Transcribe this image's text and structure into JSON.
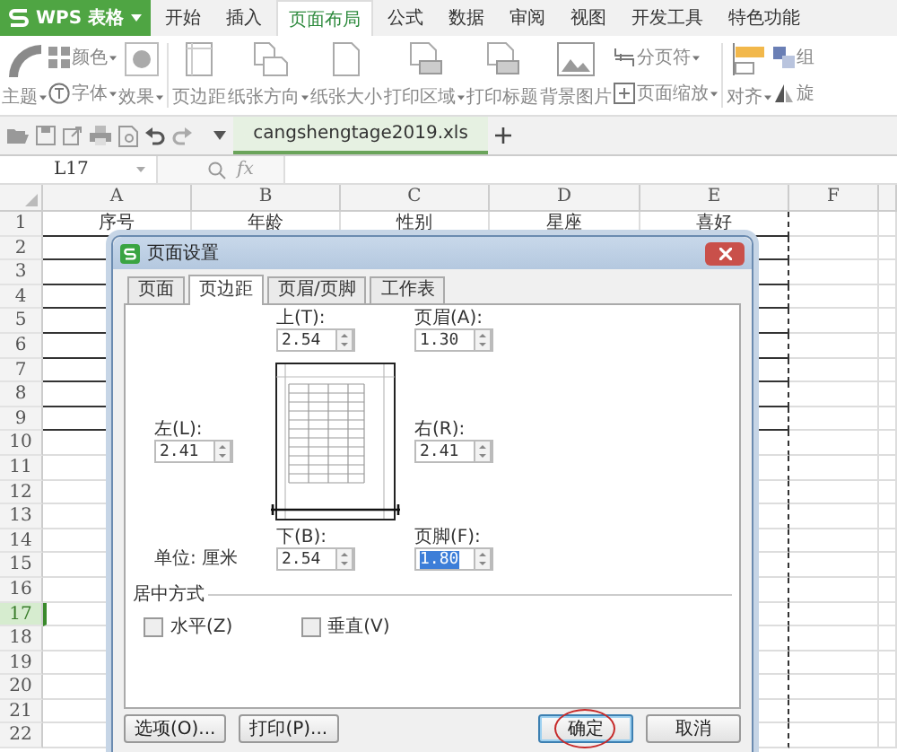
{
  "app_button": {
    "label": "WPS 表格"
  },
  "tabs": [
    {
      "label": "开始",
      "selected": false
    },
    {
      "label": "插入",
      "selected": false
    },
    {
      "label": "页面布局",
      "selected": true
    },
    {
      "label": "公式",
      "selected": false
    },
    {
      "label": "数据",
      "selected": false
    },
    {
      "label": "审阅",
      "selected": false
    },
    {
      "label": "视图",
      "selected": false
    },
    {
      "label": "开发工具",
      "selected": false
    },
    {
      "label": "特色功能",
      "selected": false
    }
  ],
  "ribbon": {
    "groups": [
      {
        "items": [
          {
            "kind": "large",
            "label": "主题",
            "dropdown": true
          },
          {
            "kind": "stack",
            "children": [
              {
                "label": "颜色",
                "dropdown": true
              },
              {
                "label": "字体",
                "dropdown": true
              }
            ]
          },
          {
            "kind": "large",
            "label": "效果",
            "dropdown": true
          }
        ]
      },
      {
        "items": [
          {
            "kind": "large",
            "label": "页边距",
            "dropdown": false
          },
          {
            "kind": "large",
            "label": "纸张方向",
            "dropdown": true
          },
          {
            "kind": "large",
            "label": "纸张大小",
            "dropdown": false
          },
          {
            "kind": "large",
            "label": "打印区域",
            "dropdown": true
          },
          {
            "kind": "large",
            "label": "打印标题",
            "dropdown": false
          },
          {
            "kind": "large",
            "label": "背景图片",
            "dropdown": false
          },
          {
            "kind": "stack",
            "children": [
              {
                "label": "分页符",
                "dropdown": true
              },
              {
                "label": "页面缩放",
                "dropdown": true
              }
            ]
          }
        ]
      },
      {
        "items": [
          {
            "kind": "large",
            "label": "对齐",
            "dropdown": true
          },
          {
            "kind": "stack",
            "children": [
              {
                "label": "组",
                "dropdown": false
              },
              {
                "label": "旋",
                "dropdown": false
              }
            ]
          }
        ]
      }
    ]
  },
  "document_tab": {
    "name": "cangshengtage2019.xls"
  },
  "name_box": {
    "value": "L17"
  },
  "formula_bar": {
    "fx_label": "fx"
  },
  "sheet": {
    "columns": [
      "A",
      "B",
      "C",
      "D",
      "E",
      "F"
    ],
    "header_cells": [
      "序号",
      "年龄",
      "性别",
      "星座",
      "喜好"
    ],
    "rows": [
      {
        "label": "1",
        "selected": false
      },
      {
        "label": "2",
        "selected": false
      },
      {
        "label": "3",
        "selected": false
      },
      {
        "label": "4",
        "selected": false
      },
      {
        "label": "5",
        "selected": false
      },
      {
        "label": "6",
        "selected": false
      },
      {
        "label": "7",
        "selected": false
      },
      {
        "label": "8",
        "selected": false
      },
      {
        "label": "9",
        "selected": false
      },
      {
        "label": "10",
        "selected": false
      },
      {
        "label": "11",
        "selected": false
      },
      {
        "label": "12",
        "selected": false
      },
      {
        "label": "13",
        "selected": false
      },
      {
        "label": "14",
        "selected": false
      },
      {
        "label": "15",
        "selected": false
      },
      {
        "label": "16",
        "selected": false
      },
      {
        "label": "17",
        "selected": true
      },
      {
        "label": "18",
        "selected": false
      },
      {
        "label": "19",
        "selected": false
      },
      {
        "label": "20",
        "selected": false
      },
      {
        "label": "21",
        "selected": false
      },
      {
        "label": "22",
        "selected": false
      }
    ]
  },
  "dialog": {
    "title": "页面设置",
    "tabs": [
      {
        "label": "页面",
        "selected": false
      },
      {
        "label": "页边距",
        "selected": true
      },
      {
        "label": "页眉/页脚",
        "selected": false
      },
      {
        "label": "工作表",
        "selected": false
      }
    ],
    "fields": {
      "top": {
        "label": "上(T):",
        "value": "2.54",
        "selected": false
      },
      "header": {
        "label": "页眉(A):",
        "value": "1.30",
        "selected": false
      },
      "left": {
        "label": "左(L):",
        "value": "2.41",
        "selected": false
      },
      "right": {
        "label": "右(R):",
        "value": "2.41",
        "selected": false
      },
      "bottom": {
        "label": "下(B):",
        "value": "2.54",
        "selected": false
      },
      "footer": {
        "label": "页脚(F):",
        "value": "1.80",
        "selected": true
      }
    },
    "unit_label": "单位: 厘米",
    "center_section": {
      "title": "居中方式",
      "checkboxes": [
        {
          "label": "水平(Z)",
          "checked": false
        },
        {
          "label": "垂直(V)",
          "checked": false
        }
      ]
    },
    "buttons": [
      {
        "label": "选项(O)...",
        "default": false,
        "circled": false
      },
      {
        "label": "打印(P)...",
        "default": false,
        "circled": false
      },
      {
        "label": "确定",
        "default": true,
        "circled": true
      },
      {
        "label": "取消",
        "default": false,
        "circled": false
      }
    ]
  }
}
